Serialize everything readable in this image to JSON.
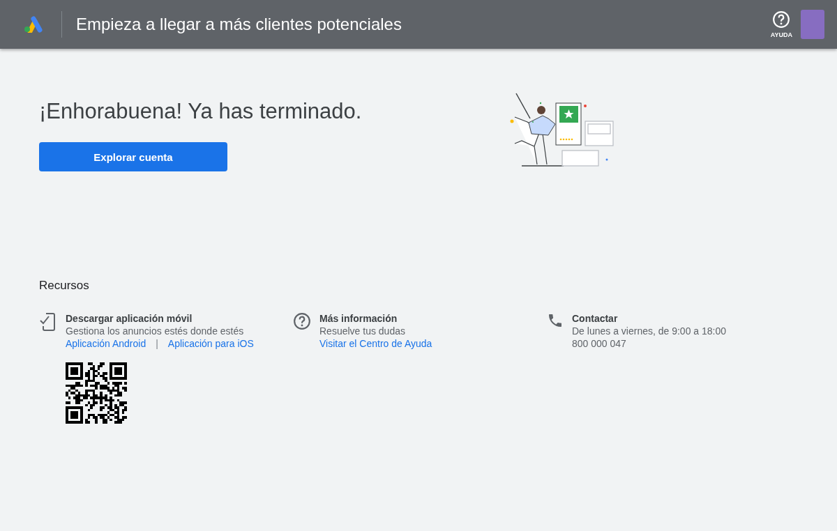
{
  "header": {
    "title": "Empieza a llegar a más clientes potenciales",
    "help_label": "AYUDA"
  },
  "hero": {
    "heading": "¡Enhorabuena! Ya has terminado.",
    "button": "Explorar cuenta"
  },
  "resources": {
    "title": "Recursos",
    "items": [
      {
        "kind": "app",
        "title": "Descargar aplicación móvil",
        "lines": [
          "Gestiona los anuncios estés donde estés"
        ],
        "links": [
          "Aplicación Android",
          "Aplicación para iOS"
        ],
        "separator": "|"
      },
      {
        "kind": "info",
        "title": "Más información",
        "lines": [
          "Resuelve tus dudas"
        ],
        "links": [
          "Visitar el Centro de Ayuda"
        ]
      },
      {
        "kind": "contact",
        "title": "Contactar",
        "lines": [
          "De lunes a viernes, de 9:00 a 18:00",
          "800 000 047"
        ]
      }
    ]
  }
}
